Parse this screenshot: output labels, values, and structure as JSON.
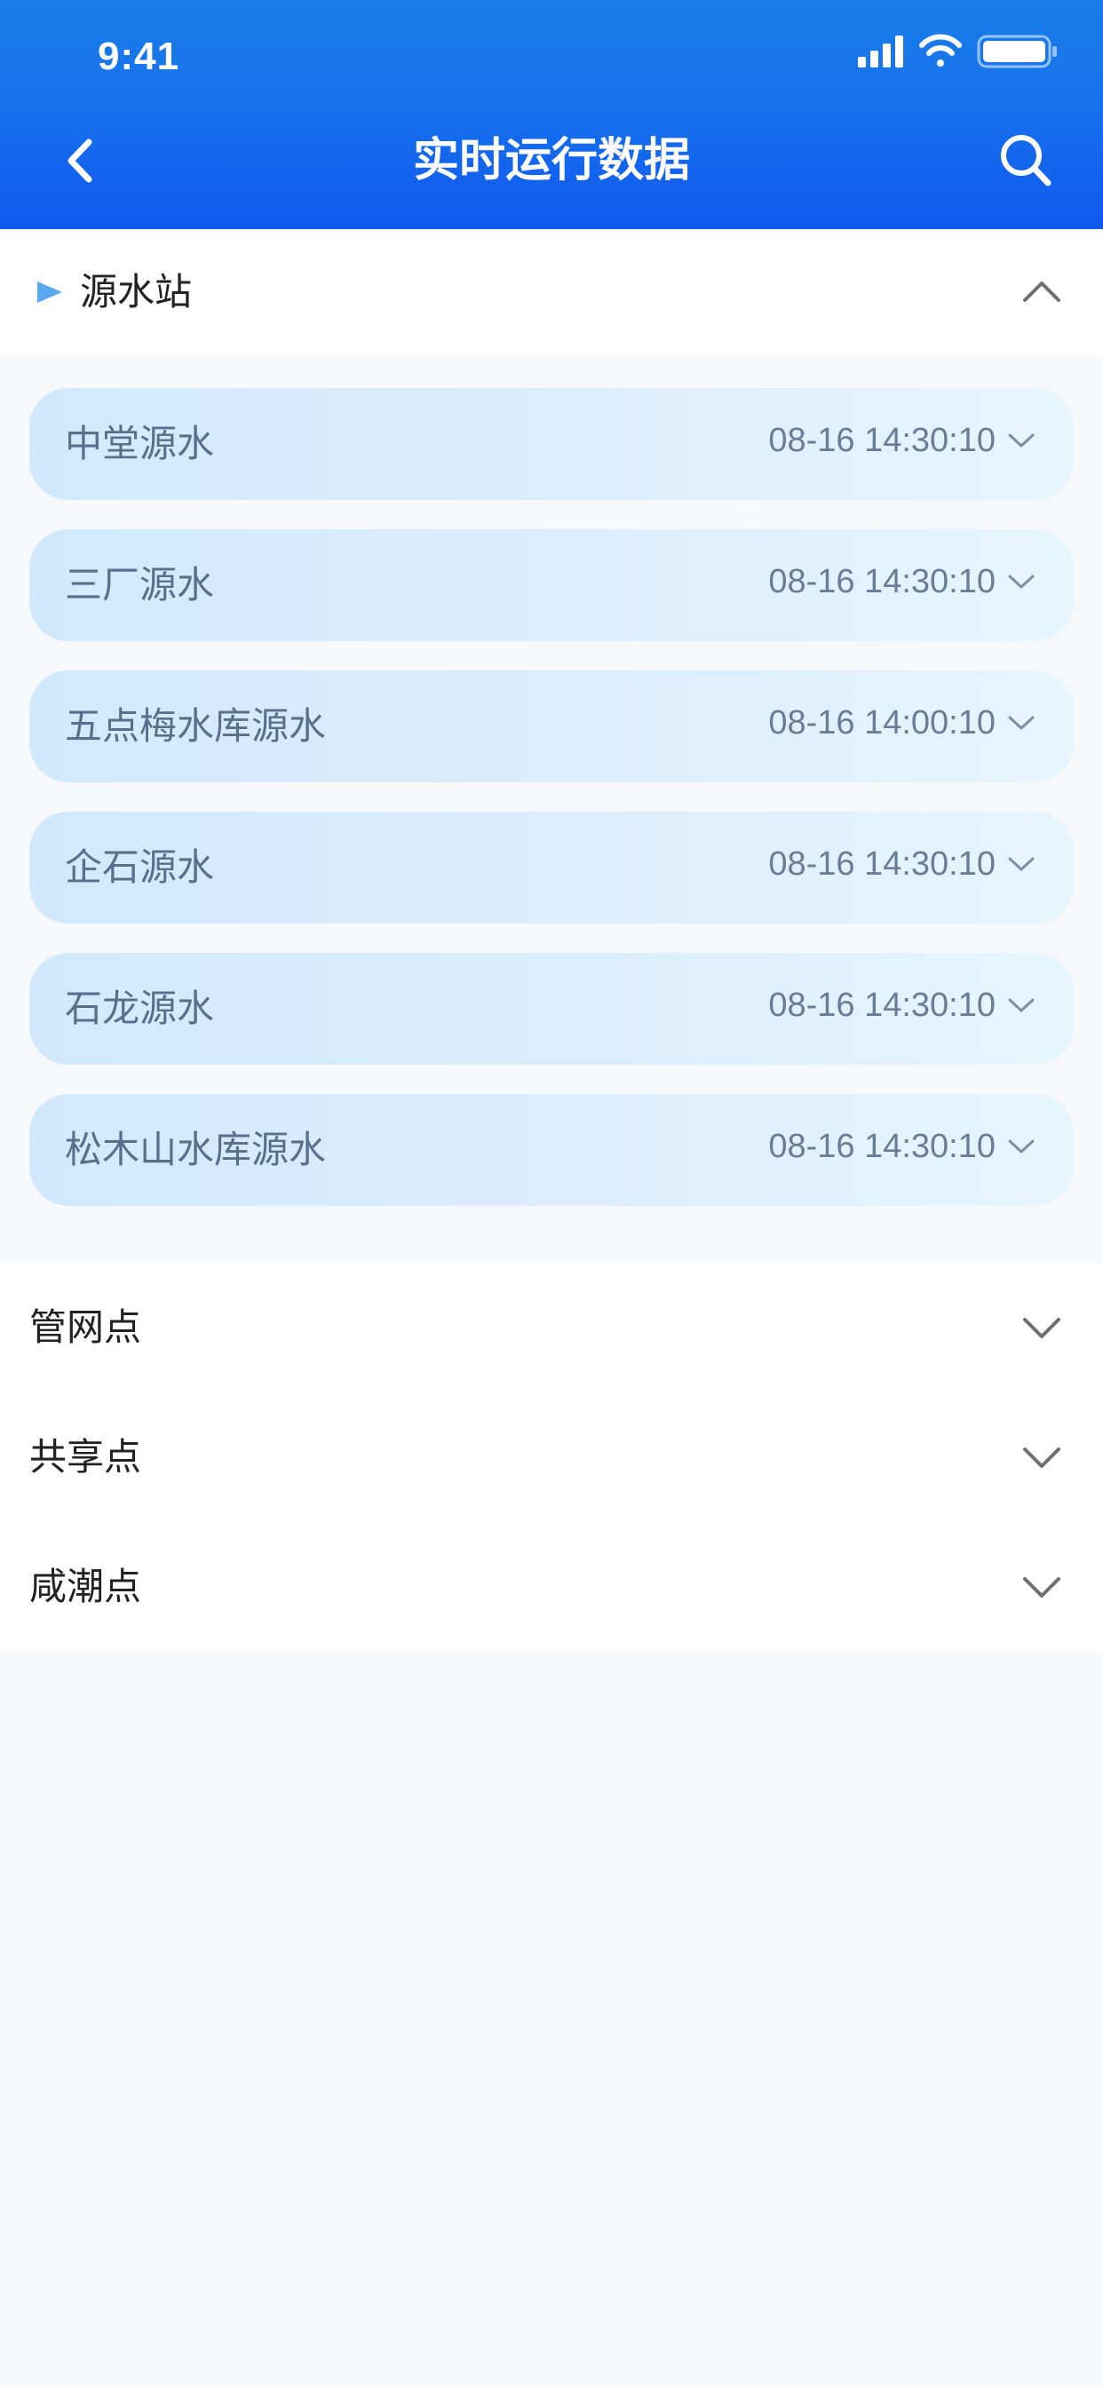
{
  "status_bar": {
    "time": "9:41",
    "icons": [
      "signal-icon",
      "wifi-icon",
      "battery-icon"
    ]
  },
  "nav": {
    "title": "实时运行数据",
    "back_icon": "chevron-left-icon",
    "search_icon": "search-icon"
  },
  "expanded_section": {
    "label": "源水站",
    "marker_icon": "play-marker-icon",
    "toggle_icon": "chevron-up-icon",
    "stations": [
      {
        "name": "中堂源水",
        "time": "08-16 14:30:10"
      },
      {
        "name": "三厂源水",
        "time": "08-16 14:30:10"
      },
      {
        "name": "五点梅水库源水",
        "time": "08-16 14:00:10"
      },
      {
        "name": "企石源水",
        "time": "08-16 14:30:10"
      },
      {
        "name": "石龙源水",
        "time": "08-16 14:30:10"
      },
      {
        "name": "松木山水库源水",
        "time": "08-16 14:30:10"
      }
    ]
  },
  "collapsed_sections": [
    {
      "label": "管网点"
    },
    {
      "label": "共享点"
    },
    {
      "label": "咸潮点"
    }
  ],
  "colors": {
    "header_top": "#1a7de8",
    "header_bottom": "#1158ef",
    "card_start": "#d2e9fd",
    "card_end": "#e7f6fe",
    "page_bg": "#f6f8fc",
    "marker": "#5aa8ef"
  }
}
